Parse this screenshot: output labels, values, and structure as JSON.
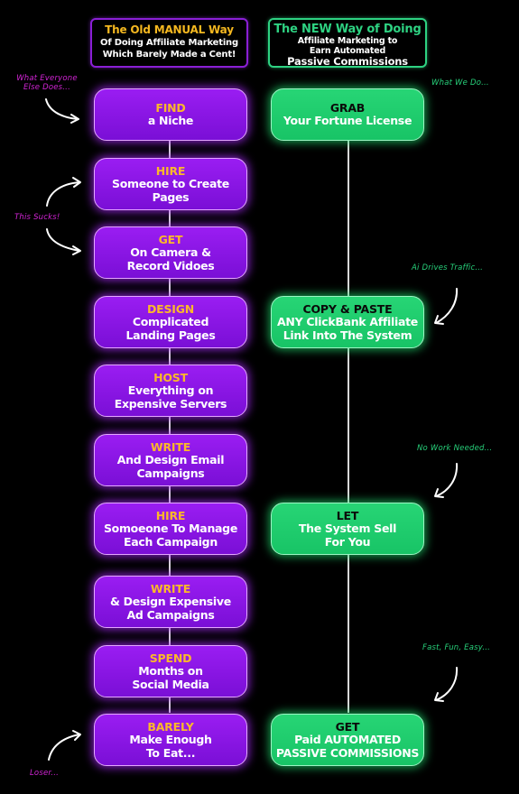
{
  "headers": {
    "old": {
      "title": "The Old MANUAL Way",
      "line1": "Of Doing Affiliate Marketing",
      "line2": "Which Barely Made a Cent!"
    },
    "new": {
      "title": "The NEW Way of Doing",
      "line1": "Affiliate Marketing to",
      "line2": "Earn Automated",
      "line3": "Passive Commissions"
    }
  },
  "old_way_steps": [
    {
      "keyword": "FIND",
      "line1": "a Niche",
      "line2": ""
    },
    {
      "keyword": "HIRE",
      "line1": "Someone to Create",
      "line2": "Pages"
    },
    {
      "keyword": "GET",
      "line1": "On Camera &",
      "line2": "Record Vidoes"
    },
    {
      "keyword": "DESIGN",
      "line1": "Complicated",
      "line2": "Landing Pages"
    },
    {
      "keyword": "HOST",
      "line1": "Everything on",
      "line2": "Expensive Servers"
    },
    {
      "keyword": "WRITE",
      "line1": "And Design Email",
      "line2": "Campaigns"
    },
    {
      "keyword": "HIRE",
      "line1": "Somoeone To Manage",
      "line2": "Each Campaign"
    },
    {
      "keyword": "WRITE",
      "line1": "& Design Expensive",
      "line2": "Ad Campaigns"
    },
    {
      "keyword": "SPEND",
      "line1": "Months on",
      "line2": "Social Media"
    },
    {
      "keyword": "BARELY",
      "line1": "Make Enough",
      "line2": "To Eat..."
    }
  ],
  "new_way_steps": [
    {
      "keyword": "GRAB",
      "line1": "Your Fortune License",
      "line2": ""
    },
    {
      "keyword": "COPY & PASTE",
      "line1": "ANY ClickBank Affiliate",
      "line2": "Link Into The System"
    },
    {
      "keyword": "LET",
      "line1": "The System Sell",
      "line2": "For You"
    },
    {
      "keyword": "GET",
      "line1": "Paid AUTOMATED",
      "line2": "PASSIVE COMMISSIONS"
    }
  ],
  "annotations": {
    "left": {
      "what_everyone": "What Everyone\nElse Does...",
      "this_sucks": "This Sucks!",
      "loser": "Loser..."
    },
    "right": {
      "what_we_do": "What We Do...",
      "ai_drives": "Ai Drives Traffic...",
      "no_work": "No Work Needed...",
      "fast_fun": "Fast, Fun, Easy..."
    }
  },
  "colors": {
    "old_accent": "#8a1fd6",
    "old_keyword": "#fbb82a",
    "new_accent": "#2ed282",
    "annotation_pink": "#d324d6",
    "annotation_green": "#27d07a"
  }
}
